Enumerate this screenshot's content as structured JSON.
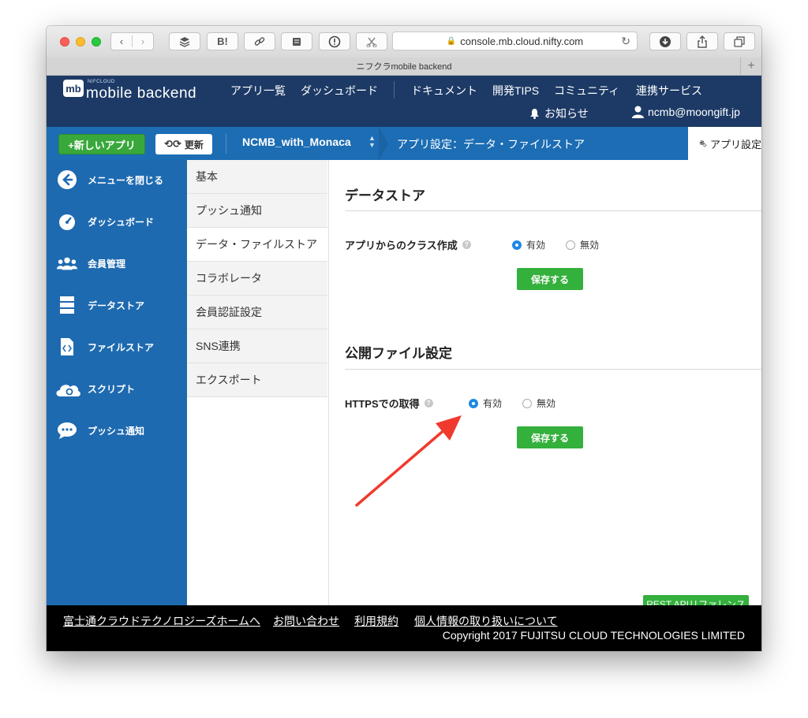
{
  "browser": {
    "url": "console.mb.cloud.nifty.com",
    "tab_title": "ニフクラmobile backend",
    "toolbar_buttons": [
      "layers-icon",
      "hatena-bookmark-icon",
      "link-icon",
      "stack-icon",
      "info-icon",
      "share-extension-icon"
    ],
    "bookmark_label": "B!"
  },
  "header": {
    "logo_small": "NIFCLOUD",
    "logo_mark": "mb",
    "logo_text": "mobile backend",
    "nav": [
      "アプリ一覧",
      "ダッシュボード",
      "ドキュメント",
      "開発TIPS",
      "コミュニティ",
      "連携サービス"
    ],
    "notice": "お知らせ",
    "user": "ncmb@moongift.jp"
  },
  "bluebar": {
    "new_app": "+新しいアプリ",
    "refresh": "更新",
    "app_name": "NCMB_with_Monaca",
    "breadcrumb": "アプリ設定：データ・ファイルストア",
    "settings_tab": "アプリ設定"
  },
  "sidebar": {
    "items": [
      {
        "label": "メニューを閉じる",
        "icon": "arrow-left-circle-icon"
      },
      {
        "label": "ダッシュボード",
        "icon": "gauge-icon"
      },
      {
        "label": "会員管理",
        "icon": "users-icon"
      },
      {
        "label": "データストア",
        "icon": "database-icon"
      },
      {
        "label": "ファイルストア",
        "icon": "file-code-icon"
      },
      {
        "label": "スクリプト",
        "icon": "cloud-gear-icon"
      },
      {
        "label": "プッシュ通知",
        "icon": "chat-bubble-icon"
      }
    ]
  },
  "subnav": {
    "items": [
      "基本",
      "プッシュ通知",
      "データ・ファイルストア",
      "コラボレータ",
      "会員認証設定",
      "SNS連携",
      "エクスポート"
    ],
    "active_index": 2
  },
  "main": {
    "datastore": {
      "heading": "データストア",
      "label": "アプリからのクラス作成",
      "help": "?",
      "option_on": "有効",
      "option_off": "無効",
      "selected": "有効",
      "save": "保存する"
    },
    "public_file": {
      "heading": "公開ファイル設定",
      "label": "HTTPSでの取得",
      "help": "?",
      "option_on": "有効",
      "option_off": "無効",
      "selected": "有効",
      "save": "保存する"
    },
    "rest_button": "REST APIリファレンス"
  },
  "footer": {
    "links": [
      "富士通クラウドテクノロジーズホームへ",
      "お問い合わせ",
      "利用規約",
      "個人情報の取り扱いについて"
    ],
    "copyright": "Copyright 2017 FUJITSU CLOUD TECHNOLOGIES LIMITED"
  },
  "colors": {
    "header_bg": "#1d3a66",
    "bluebar_bg": "#1c6db4",
    "sidebar_bg": "#1e6ab0",
    "button_green": "#34b03d",
    "radio_blue": "#1e88e5",
    "footer_bg": "#000000",
    "annotation_red": "#f03a2e"
  }
}
